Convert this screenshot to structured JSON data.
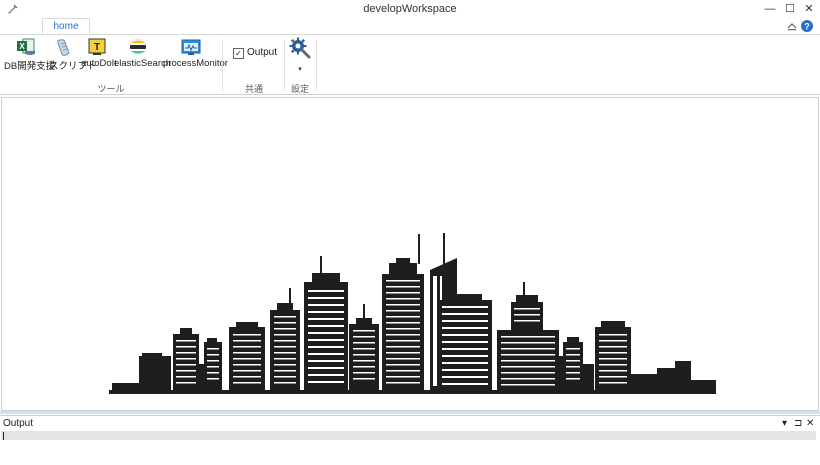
{
  "window": {
    "title": "developWorkspace",
    "minimize_glyph": "—",
    "maximize_glyph": "☐",
    "close_glyph": "✕"
  },
  "tabs": [
    {
      "label": "home"
    }
  ],
  "ribbon": {
    "tools_group": {
      "label": "ツール",
      "buttons": [
        {
          "label": "DB開発支援",
          "icon": "excel-db-icon"
        },
        {
          "label": "スクリプト",
          "icon": "script-icon"
        },
        {
          "label": "autoDoIt",
          "icon": "autodoit-icon"
        },
        {
          "label": "elasticSearch",
          "icon": "elasticsearch-icon"
        },
        {
          "label": "processMonitor",
          "icon": "process-monitor-icon"
        }
      ]
    },
    "common_group": {
      "label": "共通",
      "output_checkbox": {
        "label": "Output",
        "checked": true,
        "check_glyph": "✓"
      }
    },
    "settings_group": {
      "label": "設定",
      "icon": "settings-gear-icon",
      "dropdown_glyph": "▾"
    }
  },
  "output_panel": {
    "title": "Output",
    "dropdown_glyph": "▾",
    "pin_glyph": "⊐",
    "close_glyph": "✕"
  },
  "colors": {
    "accent": "#2a6dd2",
    "splitter": "#bfe9ee",
    "skyline": "#1e1e1e"
  }
}
